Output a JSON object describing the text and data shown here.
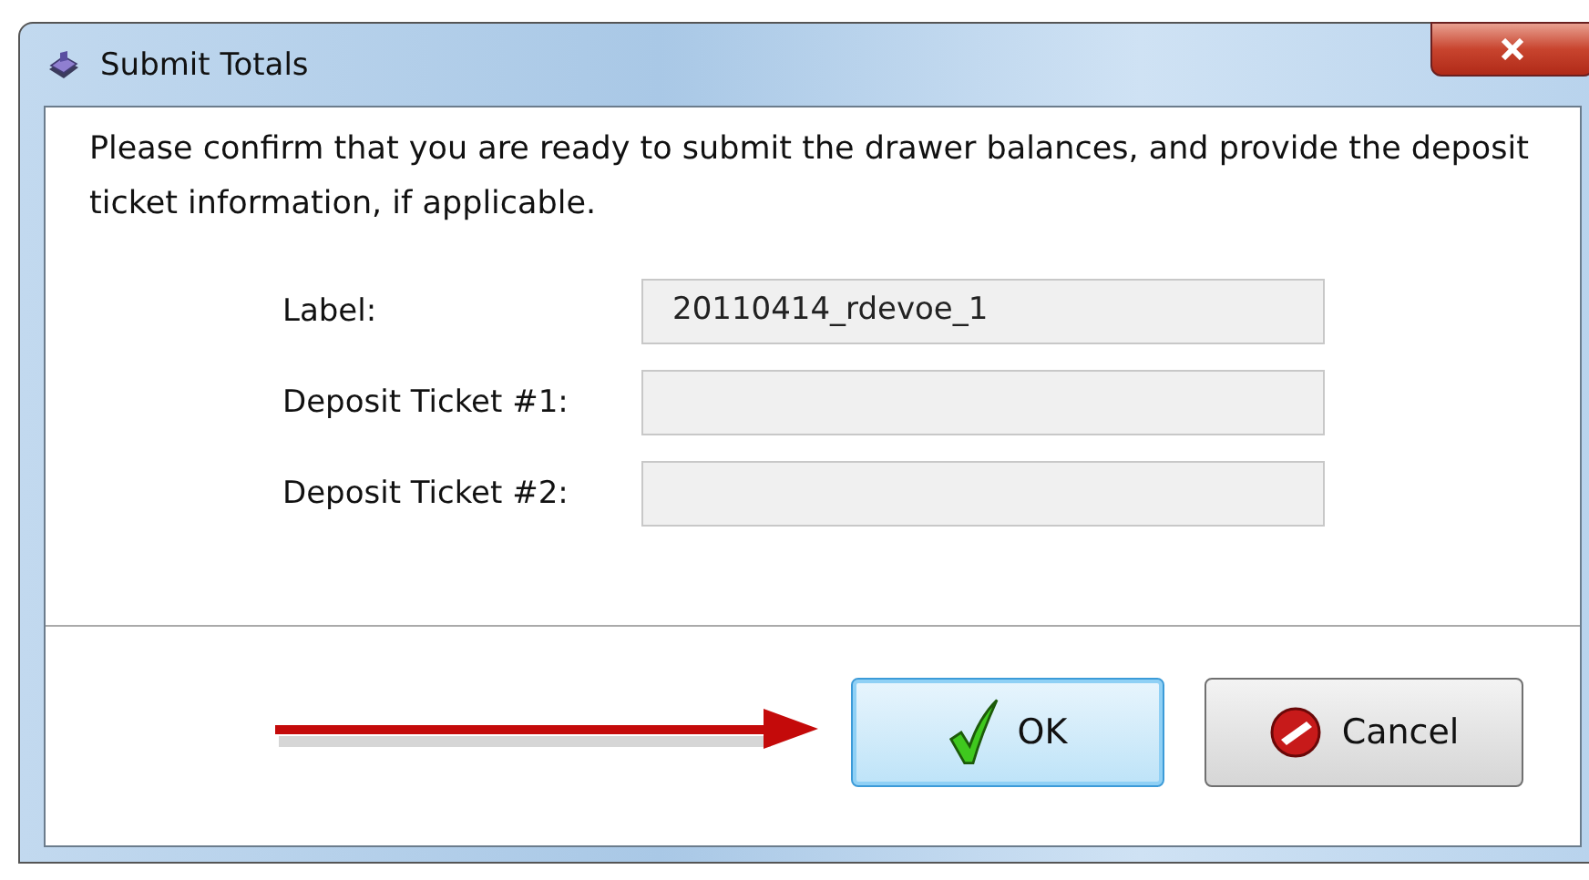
{
  "window": {
    "title": "Submit Totals"
  },
  "message": "Please confirm that you are ready to submit the drawer balances, and provide the deposit ticket information, if applicable.",
  "fields": [
    {
      "label": "Label:",
      "value": "20110414_rdevoe_1"
    },
    {
      "label": "Deposit Ticket #1:"
    },
    {
      "label": "Deposit Ticket #2:"
    }
  ],
  "buttons": [
    {
      "label": "OK",
      "kind": "ok",
      "focused": true
    },
    {
      "label": "Cancel",
      "kind": "cancel",
      "focused": false
    }
  ]
}
